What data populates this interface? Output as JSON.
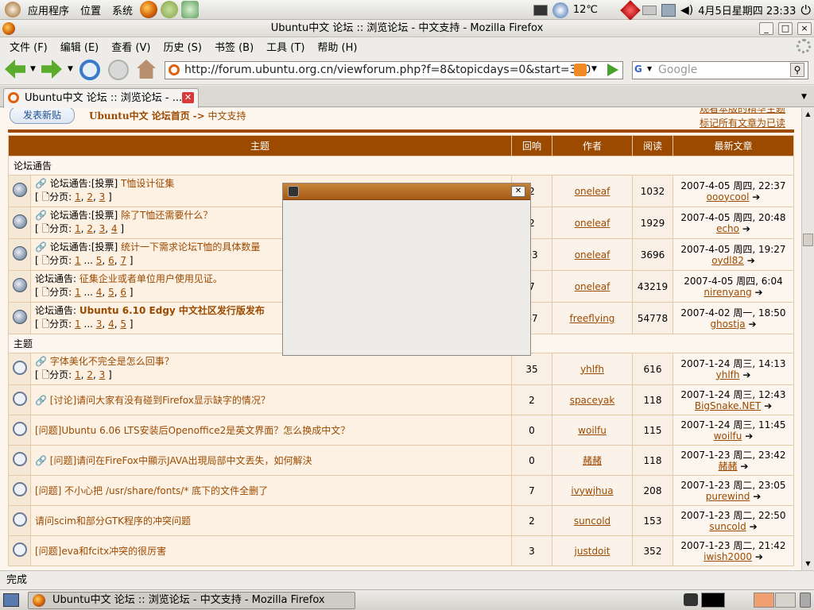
{
  "top_panel": {
    "applications": "应用程序",
    "places": "位置",
    "system": "系统",
    "temperature": "12℃",
    "datetime": "4月5日星期四 23:33"
  },
  "window": {
    "title": "Ubuntu中文 论坛 :: 浏览论坛 - 中文支持 - Mozilla Firefox",
    "minimize": "_",
    "maximize": "□",
    "close": "×"
  },
  "menubar": [
    "文件 (F)",
    "编辑 (E)",
    "查看 (V)",
    "历史 (S)",
    "书签 (B)",
    "工具 (T)",
    "帮助 (H)"
  ],
  "navbar": {
    "url": "http://forum.ubuntu.org.cn/viewforum.php?f=8&topicdays=0&start=300",
    "search_placeholder": "Google"
  },
  "tab": {
    "label": "Ubuntu中文 论坛 :: 浏览论坛 - ..."
  },
  "page": {
    "post_button": "发表新贴",
    "breadcrumb_home": "Ubuntu中文 论坛首页",
    "breadcrumb_sep": "->",
    "breadcrumb_forum": "中文支持",
    "link_view_essence": "观看本版的精华主题",
    "link_mark_read": "标记所有文章为已读"
  },
  "table": {
    "headers": {
      "topic": "主题",
      "replies": "回响",
      "author": "作者",
      "views": "阅读",
      "last": "最新文章"
    },
    "section_announcements": "论坛通告",
    "section_topics": "主题",
    "announcements": [
      {
        "prefix": "论坛通告:",
        "tag": "[投票]",
        "title": "T恤设计征集",
        "pager": [
          "1",
          "2",
          "3"
        ],
        "replies": "2",
        "author": "oneleaf",
        "views": "1032",
        "last_date": "2007-4-05 周四, 22:37",
        "last_user": "oooycool"
      },
      {
        "prefix": "论坛通告:",
        "tag": "[投票]",
        "title": "除了T恤还需要什么？",
        "pager": [
          "1",
          "2",
          "3",
          "4"
        ],
        "replies": "2",
        "author": "oneleaf",
        "views": "1929",
        "last_date": "2007-4-05 周四, 20:48",
        "last_user": "echo"
      },
      {
        "prefix": "论坛通告:",
        "tag": "[投票]",
        "title": "统计一下需求论坛T恤的具体数量",
        "pager": [
          "1",
          "...",
          "5",
          "6",
          "7"
        ],
        "replies": "03",
        "author": "oneleaf",
        "views": "3696",
        "last_date": "2007-4-05 周四, 19:27",
        "last_user": "oydl82"
      },
      {
        "prefix": "论坛通告:",
        "tag": "",
        "title": "征集企业或者单位用户使用见证。",
        "pager": [
          "1",
          "...",
          "4",
          "5",
          "6"
        ],
        "replies": "7",
        "author": "oneleaf",
        "views": "43219",
        "last_date": "2007-4-05 周四, 6:04",
        "last_user": "nirenyang"
      },
      {
        "prefix": "论坛通告:",
        "tag": "",
        "title": "Ubuntu 6.10 Edgy 中文社区发行版发布",
        "pager": [
          "1",
          "...",
          "3",
          "4",
          "5"
        ],
        "replies": "67",
        "author": "freeflying",
        "views": "54778",
        "last_date": "2007-4-02 周一, 18:50",
        "last_user": "ghostja"
      }
    ],
    "topics": [
      {
        "title": "字体美化不完全是怎么回事？",
        "pager": [
          "1",
          "2",
          "3"
        ],
        "replies": "35",
        "author": "yhlfh",
        "views": "616",
        "last_date": "2007-1-24 周三, 14:13",
        "last_user": "yhlfh"
      },
      {
        "title": "[讨论]请问大家有没有碰到Firefox显示缺字的情况？",
        "pager": [],
        "replies": "2",
        "author": "spaceyak",
        "views": "118",
        "last_date": "2007-1-24 周三, 12:43",
        "last_user": "BigSnake.NET"
      },
      {
        "title": "[问题]Ubuntu 6.06 LTS安装后Openoffice2是英文界面？怎么换成中文？",
        "pager": [],
        "replies": "0",
        "author": "woilfu",
        "views": "115",
        "last_date": "2007-1-24 周三, 11:45",
        "last_user": "woilfu"
      },
      {
        "title": "[问题]请问在FireFox中顯示JAVA出現局部中文丟失，如何解決",
        "pager": [],
        "replies": "0",
        "author": "赭赭",
        "views": "118",
        "last_date": "2007-1-23 周二, 23:42",
        "last_user": "赭赭"
      },
      {
        "title": "[问题] 不小心把 /usr/share/fonts/* 底下的文件全删了",
        "pager": [],
        "replies": "7",
        "author": "ivywjhua",
        "views": "208",
        "last_date": "2007-1-23 周二, 23:05",
        "last_user": "purewind"
      },
      {
        "title": "请问scim和部分GTK程序的冲突问题",
        "pager": [],
        "replies": "2",
        "author": "suncold",
        "views": "153",
        "last_date": "2007-1-23 周二, 22:50",
        "last_user": "suncold"
      },
      {
        "title": "[问题]eva和fcitx冲突的很厉害",
        "pager": [],
        "replies": "3",
        "author": "justdoit",
        "views": "352",
        "last_date": "2007-1-23 周二, 21:42",
        "last_user": "iwish2000"
      }
    ],
    "pager_label": "分页:"
  },
  "statusbar": {
    "text": "完成"
  },
  "taskbar": {
    "window_label": "Ubuntu中文 论坛 :: 浏览论坛 - 中文支持 - Mozilla Firefox"
  }
}
